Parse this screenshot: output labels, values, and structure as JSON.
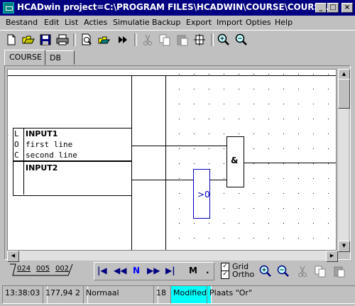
{
  "window": {
    "title": "HCADwin project=C:\\PROGRAM FILES\\HCADWIN\\COURSE\\COURSE....",
    "min_glyph": "_",
    "max_glyph": "□",
    "close_glyph": "×"
  },
  "menu": {
    "items": [
      {
        "label": "Bestand"
      },
      {
        "label": "Edit"
      },
      {
        "label": "List"
      },
      {
        "label": "Acties"
      },
      {
        "label": "Simulatie"
      },
      {
        "label": "Backup"
      },
      {
        "label": "Export"
      },
      {
        "label": "Import"
      },
      {
        "label": "Opties"
      },
      {
        "label": "Help"
      }
    ]
  },
  "toolbar": {
    "buttons": [
      "new-file-icon",
      "open-folder-icon",
      "save-icon",
      "print-icon",
      "print-preview-icon",
      "open-check-icon",
      "fast-forward-icon",
      "cut-icon",
      "copy-icon",
      "paste-icon",
      "insert-icon",
      "zoom-in-icon",
      "zoom-out-icon"
    ]
  },
  "tabs": [
    {
      "label": "COURSE",
      "active": true
    },
    {
      "label": "DB",
      "active": false
    }
  ],
  "diagram": {
    "input1": {
      "marker_l": "L",
      "marker_o": "O",
      "marker_c": "C",
      "name": "INPUT1",
      "line1": "first line",
      "line2": "second line"
    },
    "input2": {
      "name": "INPUT2"
    },
    "and_gate_label": "&",
    "compare_label": ">0",
    "compare_color": "#0000c0"
  },
  "sheets": {
    "tabs": [
      "024",
      "005",
      "002"
    ]
  },
  "nav": {
    "first": "|◀",
    "prev": "◀◀",
    "n_label": "N",
    "next": "▶▶",
    "last": "▶|",
    "m_label": "M",
    "dot": ".",
    "grid_label": "Grid",
    "ortho_label": "Ortho",
    "grid_checked": true,
    "ortho_checked": true,
    "check_glyph": "✓"
  },
  "status": {
    "time": "13:38:03",
    "coords": "177,94 2",
    "mode": "Normaal",
    "number": "18",
    "modified": "Modified",
    "message": "Plaats \"Or\"",
    "modified_color": "#00ffff"
  }
}
